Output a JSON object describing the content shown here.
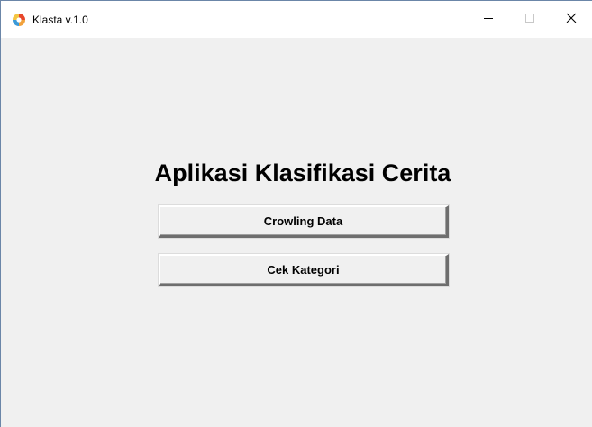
{
  "window": {
    "title": "Klasta v.1.0",
    "icon": "klasta-app-icon",
    "controls": {
      "minimize_icon": "minimize-icon",
      "maximize_icon": "maximize-icon",
      "close_icon": "close-icon"
    }
  },
  "main": {
    "heading": "Aplikasi Klasifikasi Cerita",
    "buttons": [
      {
        "label": "Crowling Data"
      },
      {
        "label": "Cek Kategori"
      }
    ]
  },
  "colors": {
    "background": "#f0f0f0",
    "titlebar": "#ffffff",
    "button_face": "#f0f0f0",
    "button_shadow": "#6e6e6e"
  }
}
